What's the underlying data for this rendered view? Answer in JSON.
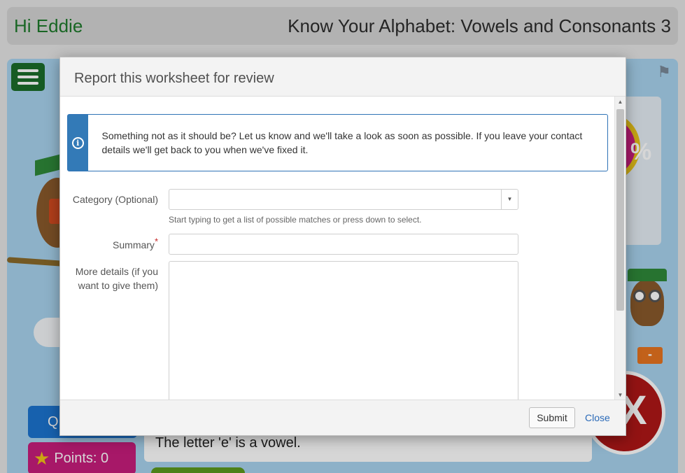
{
  "header": {
    "greeting": "Hi Eddie",
    "worksheet_title": "Know Your Alphabet: Vowels and Consonants 3"
  },
  "sidebar": {
    "q_label": "Q",
    "points_label": "Points: 0"
  },
  "board": {
    "score_text": "%",
    "minus_label": "-",
    "x_label": "X",
    "question_text": "The letter 'e' is a vowel."
  },
  "modal": {
    "title": "Report this worksheet for review",
    "alert_text": "Something not as it should be? Let us know and we'll take a look as soon as possible. If you leave your contact details we'll get back to you when we've fixed it.",
    "form": {
      "category_label": "Category (Optional)",
      "category_value": "",
      "category_help": "Start typing to get a list of possible matches or press down to select.",
      "summary_label": "Summary",
      "summary_required_mark": "*",
      "summary_value": "",
      "details_label": "More details (if you want to give them)",
      "details_value": ""
    },
    "footer": {
      "submit_label": "Submit",
      "close_label": "Close"
    }
  },
  "colors": {
    "greeting": "#1e7a2c",
    "alert_accent": "#337ab7",
    "link": "#2a6ab8",
    "required": "#c62828"
  },
  "icons": {
    "alert": "info-circle-icon",
    "menu": "hamburger-menu-icon",
    "flag": "flag-icon",
    "points": "star-icon",
    "dropdown": "caret-down-icon"
  }
}
